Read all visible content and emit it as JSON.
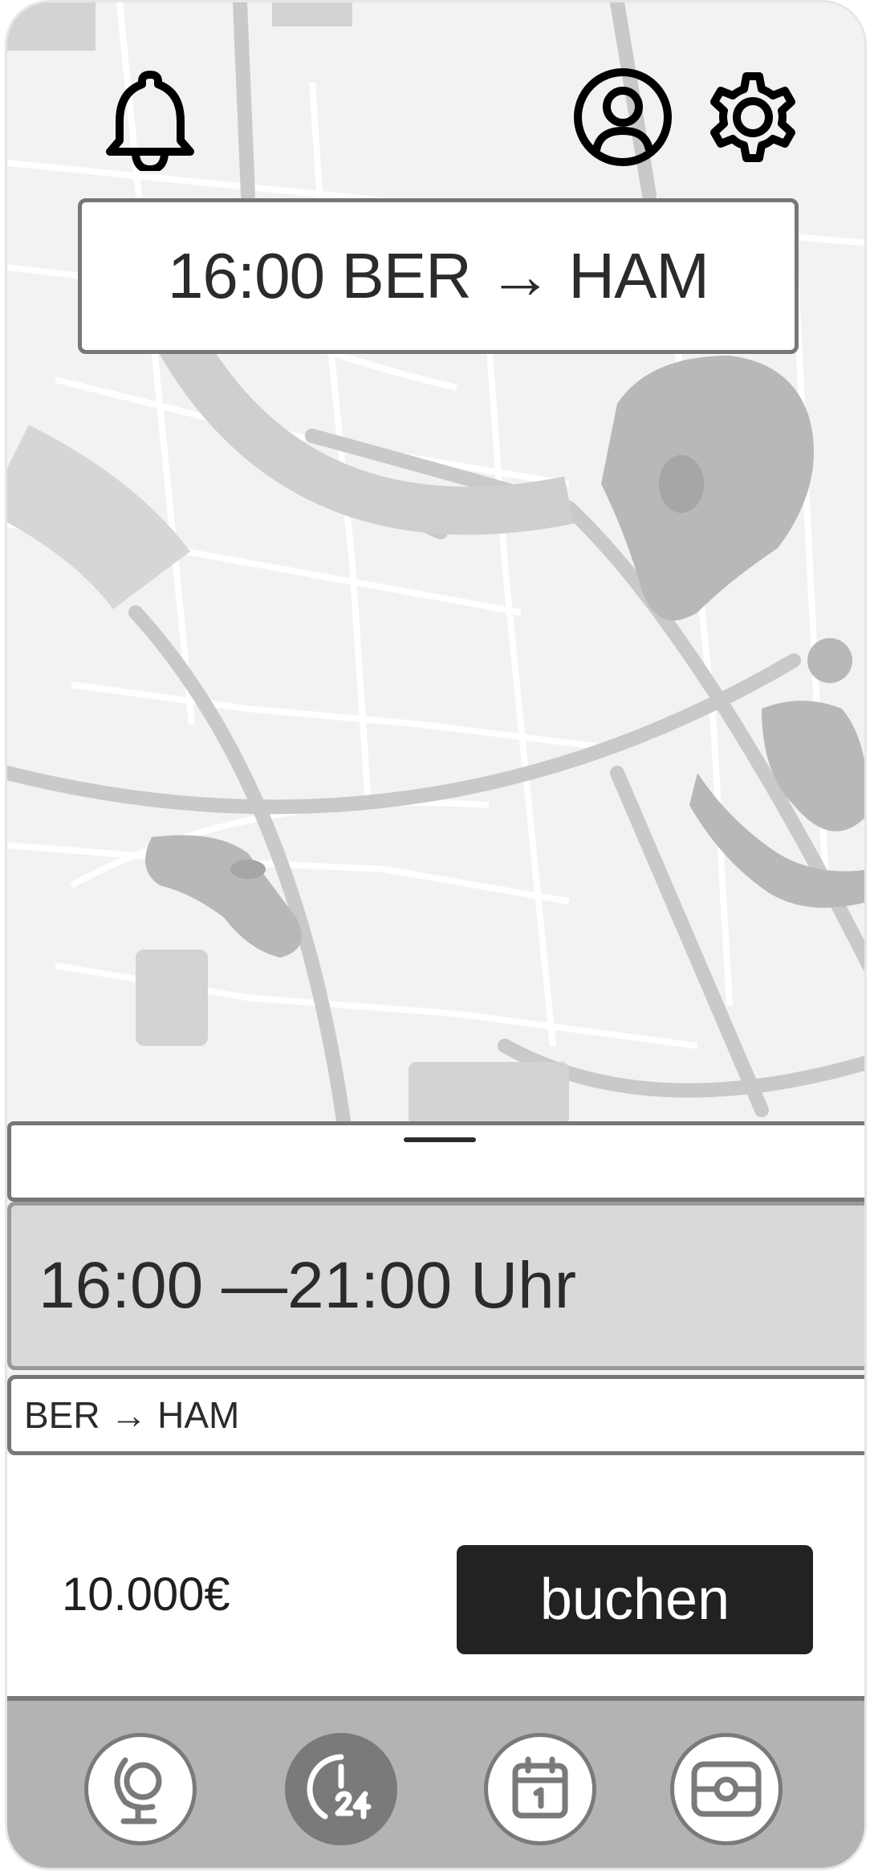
{
  "header": {
    "icons": {
      "notifications": "bell-icon",
      "profile": "user-circle-icon",
      "settings": "gear-icon"
    },
    "route_title": "16:00 BER → HAM"
  },
  "sheet": {
    "time_range": "16:00 —21:00 Uhr",
    "route": "BER → HAM",
    "price": "10.000€",
    "book_label": "buchen"
  },
  "bottom_nav": {
    "items": [
      {
        "icon": "globe-icon",
        "active": false
      },
      {
        "icon": "clock-24h-icon",
        "active": true
      },
      {
        "icon": "calendar-icon",
        "active": false
      },
      {
        "icon": "ticket-icon",
        "active": false
      }
    ]
  },
  "colors": {
    "map_background": "#f2f2f2",
    "map_roads": "#c9c9c9",
    "map_water": "#b8b8b8",
    "button_dark": "#222222",
    "nav_bar": "#b3b3b3"
  }
}
